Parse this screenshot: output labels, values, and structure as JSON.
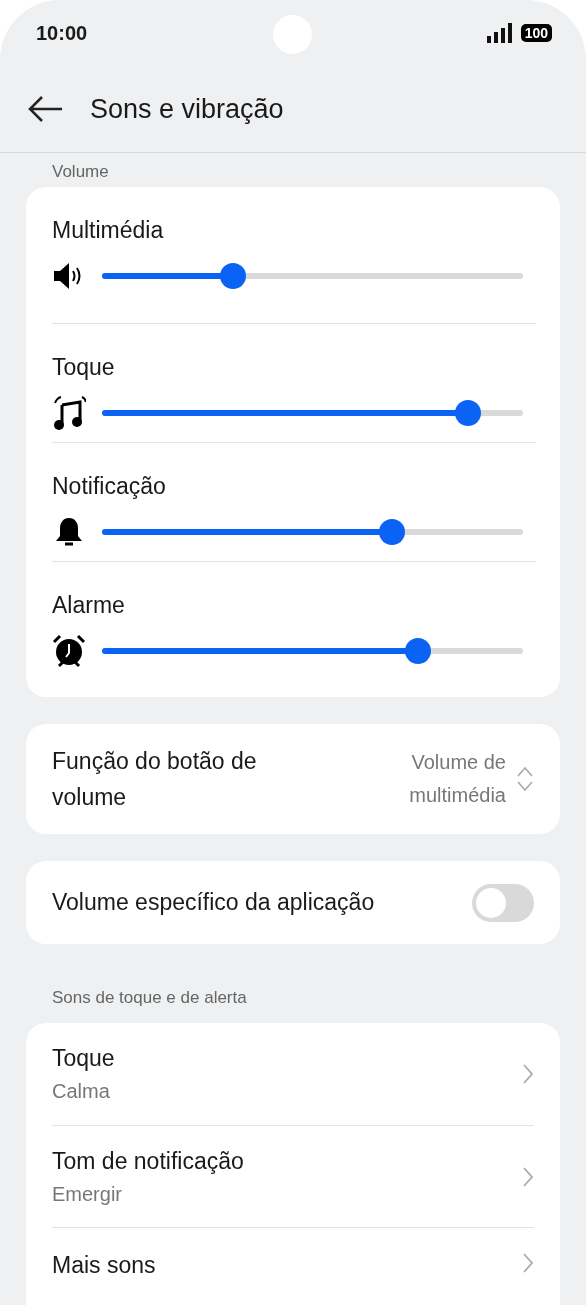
{
  "status_bar": {
    "time": "10:00",
    "battery": "100"
  },
  "header": {
    "title": "Sons e vibração"
  },
  "volume_section": {
    "label": "Volume",
    "sliders": [
      {
        "label": "Multimédia",
        "level": 0.31
      },
      {
        "label": "Toque",
        "level": 0.87
      },
      {
        "label": "Notificação",
        "level": 0.69
      },
      {
        "label": "Alarme",
        "level": 0.75
      }
    ]
  },
  "volume_button": {
    "label": "Função do botão de volume",
    "value": "Volume de multimédia"
  },
  "app_volume": {
    "label": "Volume específico da aplicação",
    "on": false
  },
  "alerts_section": {
    "label": "Sons de toque e de alerta",
    "items": [
      {
        "title": "Toque",
        "subtitle": "Calma"
      },
      {
        "title": "Tom de notificação",
        "subtitle": "Emergir"
      },
      {
        "title": "Mais sons"
      }
    ]
  }
}
